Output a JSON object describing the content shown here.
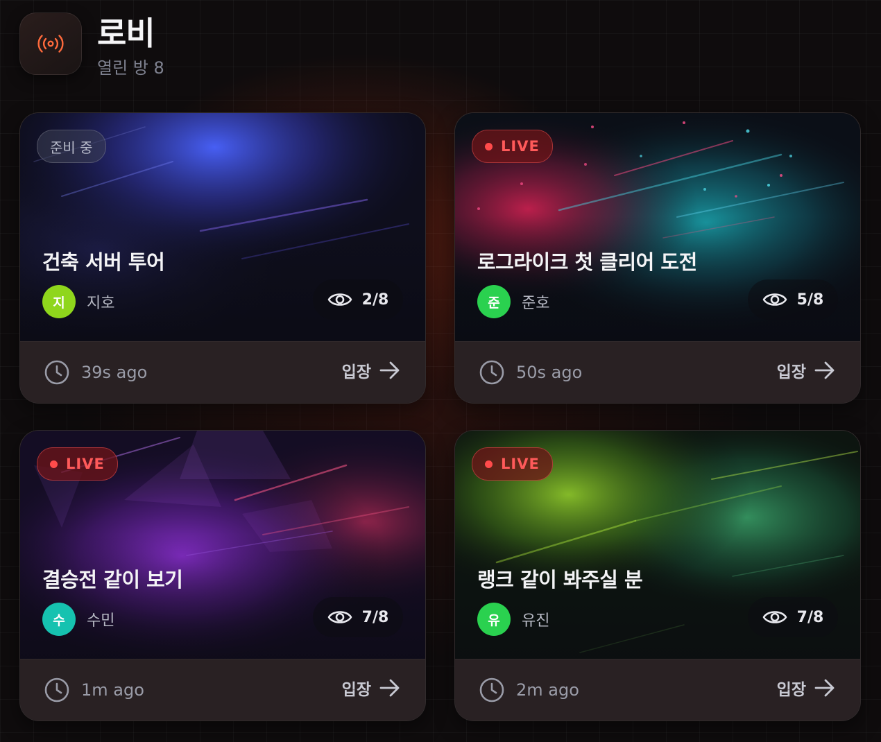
{
  "header": {
    "title": "로비",
    "subtitle": "열린 방 8",
    "icon": "broadcast-icon"
  },
  "colors": {
    "accent": "#ff6a3c",
    "live": "#ff4b4b"
  },
  "rooms": [
    {
      "status": "준비 중",
      "title": "건축 서버 투어",
      "host": "지호",
      "avatar_initial": "지",
      "avatar_color": "#8fd61c",
      "viewers": "2/8",
      "time": "39s ago",
      "enter_label": "입장"
    },
    {
      "status": "LIVE",
      "title": "로그라이크 첫 클리어 도전",
      "host": "준호",
      "avatar_initial": "준",
      "avatar_color": "#2ad14f",
      "viewers": "5/8",
      "time": "50s ago",
      "enter_label": "입장"
    },
    {
      "status": "LIVE",
      "title": "결승전 같이 보기",
      "host": "수민",
      "avatar_initial": "수",
      "avatar_color": "#16c2b0",
      "viewers": "7/8",
      "time": "1m ago",
      "enter_label": "입장"
    },
    {
      "status": "LIVE",
      "title": "랭크 같이 봐주실 분",
      "host": "유진",
      "avatar_initial": "유",
      "avatar_color": "#2ad14f",
      "viewers": "7/8",
      "time": "2m ago",
      "enter_label": "입장"
    }
  ]
}
